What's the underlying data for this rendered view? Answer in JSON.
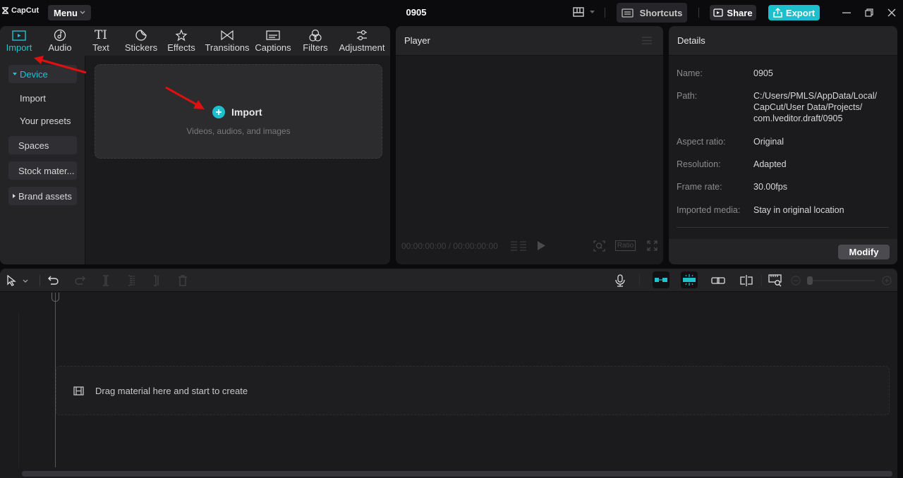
{
  "app": {
    "logo_text": "CapCut",
    "menu_label": "Menu",
    "project_title": "0905",
    "shortcuts_label": "Shortcuts",
    "share_label": "Share",
    "export_label": "Export",
    "accent_color": "#1cc0cc"
  },
  "media_tabs": [
    {
      "label": "Import",
      "icon": "import-icon",
      "active": true
    },
    {
      "label": "Audio",
      "icon": "audio-icon"
    },
    {
      "label": "Text",
      "icon": "text-icon"
    },
    {
      "label": "Stickers",
      "icon": "sticker-icon"
    },
    {
      "label": "Effects",
      "icon": "effects-icon"
    },
    {
      "label": "Transitions",
      "icon": "transitions-icon"
    },
    {
      "label": "Captions",
      "icon": "captions-icon"
    },
    {
      "label": "Filters",
      "icon": "filters-icon"
    },
    {
      "label": "Adjustment",
      "icon": "adjustment-icon"
    }
  ],
  "sidebar": {
    "device": "Device",
    "import": "Import",
    "your_presets": "Your presets",
    "spaces": "Spaces",
    "stock_material": "Stock mater...",
    "brand_assets": "Brand assets"
  },
  "import_zone": {
    "title": "Import",
    "subtitle": "Videos, audios, and images"
  },
  "player": {
    "title": "Player",
    "timecode": "00:00:00:00 / 00:00:00:00",
    "ratio_label": "Ratio"
  },
  "details": {
    "title": "Details",
    "rows": [
      {
        "label": "Name:",
        "value": "0905"
      },
      {
        "label": "Path:",
        "value": "C:/Users/PMLS/AppData/Local/ CapCut/User Data/Projects/ com.lveditor.draft/0905"
      },
      {
        "label": "Aspect ratio:",
        "value": "Original"
      },
      {
        "label": "Resolution:",
        "value": "Adapted"
      },
      {
        "label": "Frame rate:",
        "value": "30.00fps"
      },
      {
        "label": "Imported media:",
        "value": "Stay in original location"
      }
    ],
    "modify_label": "Modify"
  },
  "timeline": {
    "drop_text": "Drag material here and start to create"
  }
}
